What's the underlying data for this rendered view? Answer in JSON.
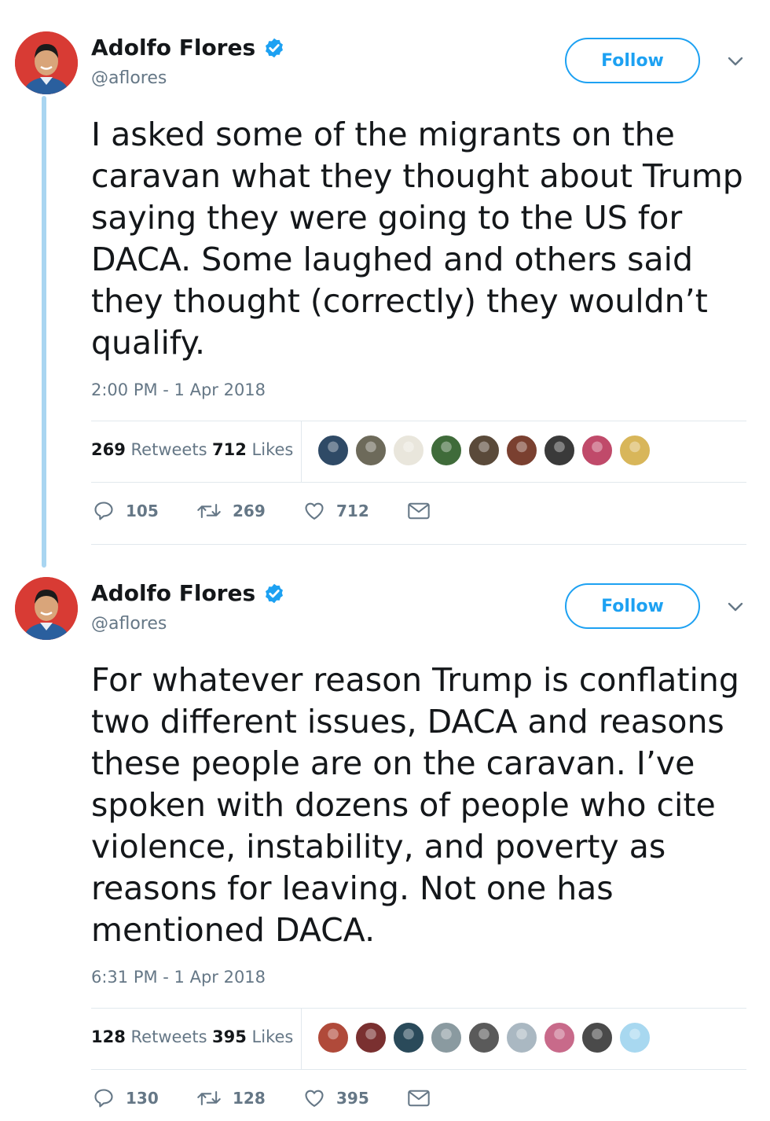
{
  "tweets": [
    {
      "author": {
        "name": "Adolfo Flores",
        "handle": "@aflores"
      },
      "follow_label": "Follow",
      "text": "I asked some of the migrants on the caravan what they thought about Trump saying they were going to the US for DACA. Some laughed and others said they thought (correctly) they wouldn’t qualify.",
      "timestamp": "2:00 PM - 1 Apr 2018",
      "stats": {
        "retweets_count": "269",
        "retweets_label": "Retweets",
        "likes_count": "712",
        "likes_label": "Likes"
      },
      "actions": {
        "replies": "105",
        "retweets": "269",
        "likes": "712"
      },
      "liker_avatar_colors": [
        "#2f4a66",
        "#6d6a5a",
        "#e9e6dc",
        "#3f6b3a",
        "#5a4a3a",
        "#7a4030",
        "#3a3a3a",
        "#c04a6a",
        "#d8b65a"
      ]
    },
    {
      "author": {
        "name": "Adolfo Flores",
        "handle": "@aflores"
      },
      "follow_label": "Follow",
      "text": "For whatever reason Trump is conflating two different issues, DACA and reasons these people are on the caravan. I’ve spoken with dozens of people who cite violence, instability, and poverty as reasons for leaving. Not one has mentioned DACA.",
      "timestamp": "6:31 PM - 1 Apr 2018",
      "stats": {
        "retweets_count": "128",
        "retweets_label": "Retweets",
        "likes_count": "395",
        "likes_label": "Likes"
      },
      "actions": {
        "replies": "130",
        "retweets": "128",
        "likes": "395"
      },
      "liker_avatar_colors": [
        "#b04a3a",
        "#7a3030",
        "#2a4a5a",
        "#8a9aa0",
        "#5a5a5a",
        "#aab8c2",
        "#c86a8a",
        "#4a4a4a",
        "#a8d8f0"
      ]
    }
  ],
  "colors": {
    "accent": "#1da1f2",
    "muted": "#657786",
    "thread_line": "#a9d5f1",
    "avatar_bg": "#d83b34"
  },
  "icons": [
    "verified-badge-icon",
    "chevron-down-icon",
    "reply-icon",
    "retweet-icon",
    "like-icon",
    "direct-message-icon"
  ]
}
